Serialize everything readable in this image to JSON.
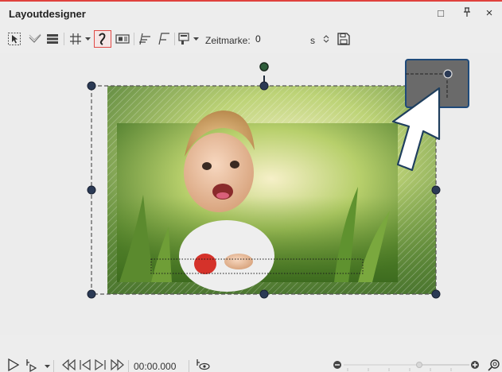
{
  "window": {
    "title": "Layoutdesigner",
    "buttons": {
      "maximize": "□",
      "pin": "⊥",
      "close": "×"
    }
  },
  "toolbar": {
    "timestamp_label": "Zeitmarke:",
    "timestamp_value": "0",
    "timestamp_unit": "s"
  },
  "player": {
    "timecode": "00:00.000"
  },
  "colors": {
    "accent_border": "#e0413d",
    "handle": "#2b3a55",
    "rotate_handle": "#2e5d3a",
    "callout_fill": "#6a6a6a",
    "callout_border": "#1f4a7a"
  },
  "icons": [
    "select-icon",
    "check-icon",
    "layers-icon",
    "grid-icon",
    "curve-path-icon",
    "camera-frame-icon",
    "align-left-icon",
    "align-edge-icon",
    "stamp-icon",
    "save-icon",
    "play-icon",
    "play-step-icon",
    "rewind-icon",
    "prev-icon",
    "next-icon",
    "forward-icon",
    "preview-icon",
    "zoom-out-icon",
    "zoom-in-icon",
    "zoom-fit-icon"
  ],
  "zoom": {
    "level_fraction": 0.6
  }
}
